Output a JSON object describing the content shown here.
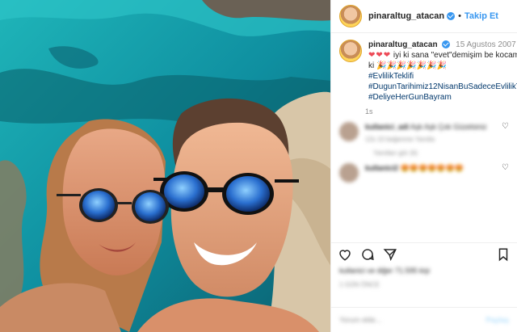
{
  "post": {
    "username": "pinaraltug_atacan",
    "dot": "•",
    "follow_label": "Takip Et",
    "date": "15 Agustos 2007",
    "hearts": "❤❤❤",
    "caption_text": "iyi ki sana \"evet\"demişim be kocam,iyi ki",
    "emojis": "🎉🎉🎉🎉🎉🎉🎉",
    "hashtags": [
      "#EvlilikTeklifi",
      "#DugunTarihimiz12NisanBuSadeceEvlilikTeklifi",
      "#DeliyeHerGunBayram"
    ],
    "time_short": "1s"
  },
  "comments": [
    {
      "name_blurred": "kullanici_adi",
      "text_blurred": "Aşk Aşk Çok Güzelsiniz",
      "meta_blurred": "12s   10 beğenme   Yanıtla",
      "replies_blurred": "Yanıtları gör (6)"
    },
    {
      "name_blurred": "kullanici2",
      "text_blurred": "😍😍😍😍😍😍😍",
      "meta_blurred": "",
      "replies_blurred": ""
    }
  ],
  "footer": {
    "likes_blurred": "kullanici ve diğer 71.595 kişi",
    "ago_blurred": "1 GÜN ÖNCE",
    "add_comment": "Yorum ekle...",
    "post_label": "Paylaş"
  }
}
